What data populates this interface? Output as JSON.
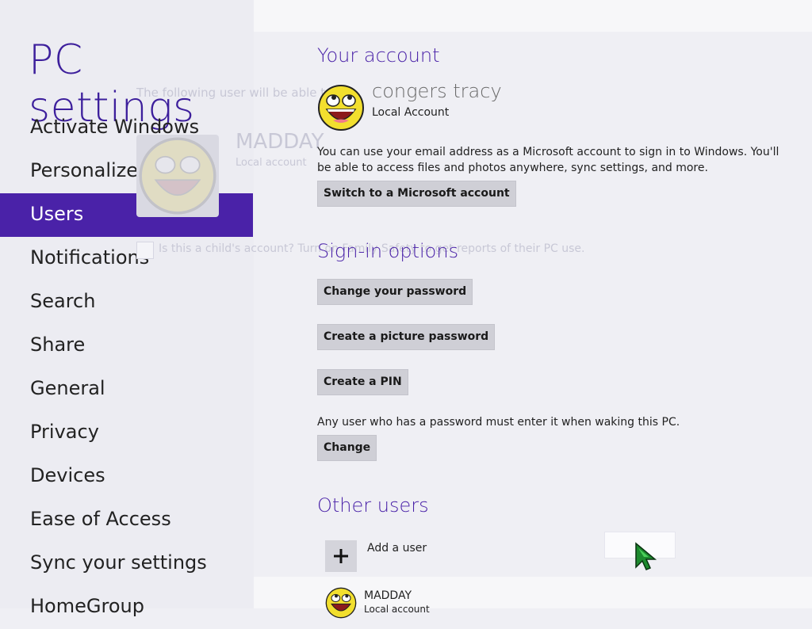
{
  "background_dialog": {
    "line1": "The following user will be able to",
    "user_name": "MADDAY",
    "user_sub": "Local account",
    "question": "Is this a child's account? Turn on Family Safety to get reports of their PC use."
  },
  "nav": {
    "title": "PC settings",
    "active_color": "#4a22a8",
    "items": [
      {
        "label": "Activate Windows"
      },
      {
        "label": "Personalize"
      },
      {
        "label": "Users"
      },
      {
        "label": "Notifications"
      },
      {
        "label": "Search"
      },
      {
        "label": "Share"
      },
      {
        "label": "General"
      },
      {
        "label": "Privacy"
      },
      {
        "label": "Devices"
      },
      {
        "label": "Ease of Access"
      },
      {
        "label": "Sync your settings"
      },
      {
        "label": "HomeGroup"
      }
    ],
    "active_index": 2
  },
  "account": {
    "heading": "Your account",
    "name": "congers tracy",
    "type": "Local Account",
    "description": "You can use your email address as a Microsoft account to sign in to Windows. You'll be able to access files and photos anywhere, sync settings, and more.",
    "switch_button": "Switch to a Microsoft account"
  },
  "signin": {
    "heading": "Sign-in options",
    "change_password_button": "Change your password",
    "picture_password_button": "Create a picture password",
    "pin_button": "Create a PIN",
    "wake_text": "Any user who has a password must enter it when waking this PC.",
    "change_button": "Change"
  },
  "other_users": {
    "heading": "Other users",
    "add_user_label": "Add a user",
    "users": [
      {
        "name": "MADDAY",
        "type": "Local account"
      }
    ]
  },
  "icons": {
    "avatar": "smiley-face-icon",
    "add": "plus-icon",
    "cursor": "green-arrow-cursor-icon"
  }
}
